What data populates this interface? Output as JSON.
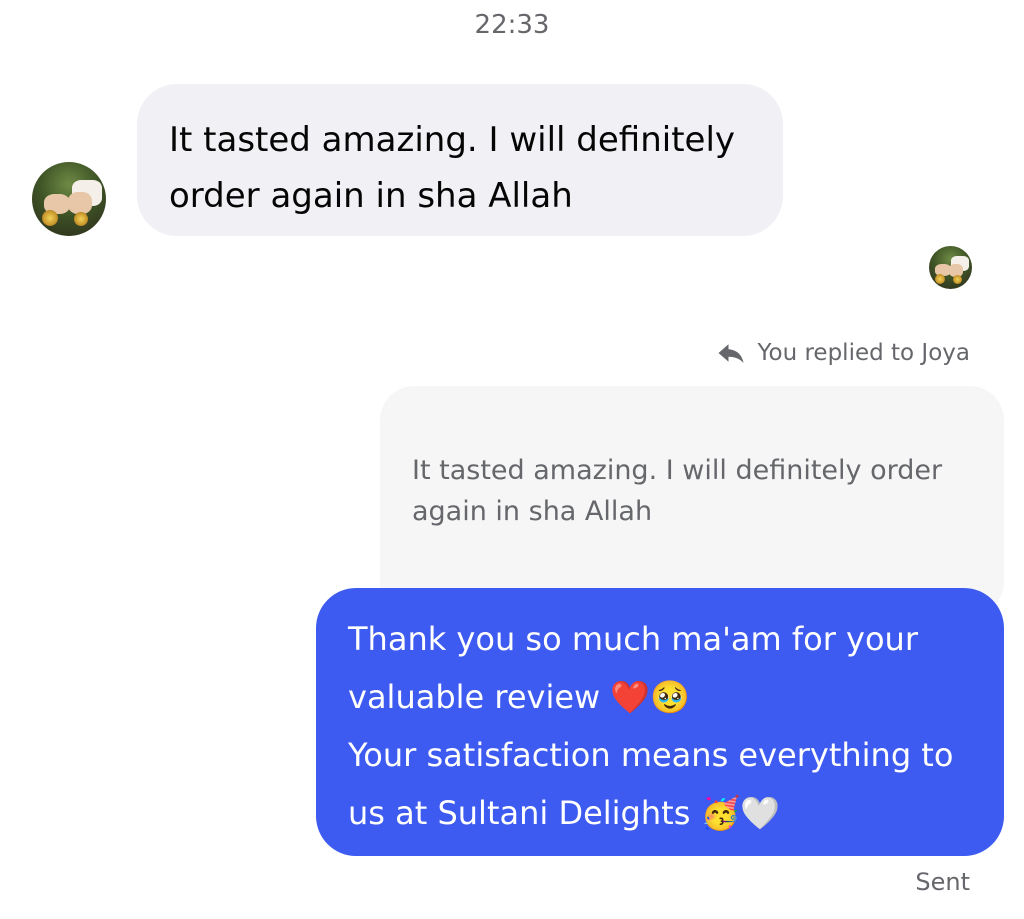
{
  "conversation": {
    "timestamp": "22:33",
    "incoming_message": {
      "text": "It tasted amazing. I will definitely order again in sha Allah",
      "bubble_color": "#f0f0f5"
    },
    "reply": {
      "label": "You replied to Joya",
      "icon": "reply-arrow-icon",
      "quoted_text": "It tasted amazing. I will definitely order again in sha Allah"
    },
    "outgoing_message": {
      "text": "Thank you so much ma'am for your valuable review ❤️🥹\nYour satisfaction means everything to us at Sultani Delights 🥳🤍",
      "bubble_color": "#3d5af1"
    },
    "status": "Sent"
  }
}
